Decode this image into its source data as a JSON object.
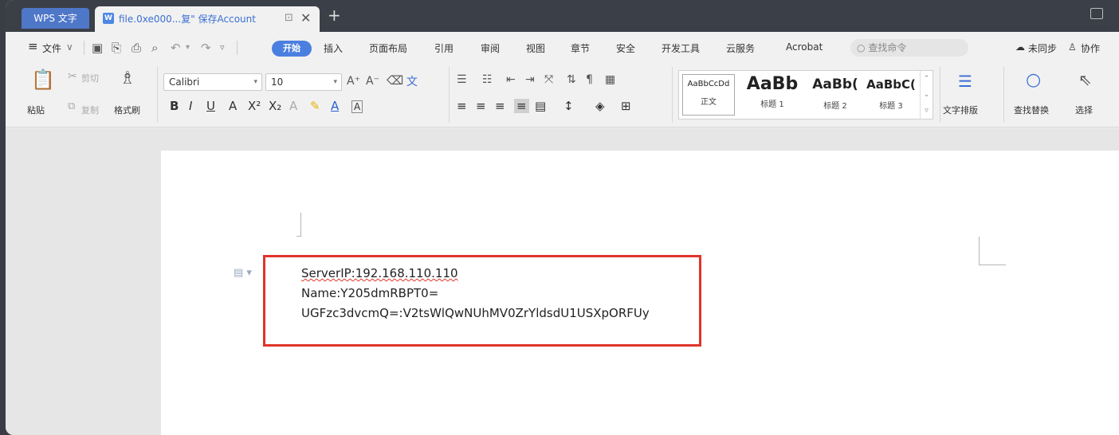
{
  "tabs": {
    "app": "WPS 文字",
    "document": "file.0xe000...复\" 保存Account",
    "new_tab": "+"
  },
  "menu": {
    "hamburger": "≡",
    "file": "文件",
    "start": "开始",
    "items": [
      "插入",
      "页面布局",
      "引用",
      "审阅",
      "视图",
      "章节",
      "安全",
      "开发工具",
      "云服务",
      "Acrobat"
    ],
    "search_placeholder": "查找命令",
    "sync": "未同步",
    "collab": "协作"
  },
  "ribbon": {
    "paste": "粘贴",
    "cut": "剪切",
    "copy": "复制",
    "format_painter": "格式刷",
    "font_name": "Calibri",
    "font_size": "10",
    "styles": [
      {
        "preview": "AaBbCcDd",
        "name": "正文"
      },
      {
        "preview": "AaBb",
        "name": "标题 1"
      },
      {
        "preview": "AaBb(",
        "name": "标题 2"
      },
      {
        "preview": "AaBbC(",
        "name": "标题 3"
      }
    ],
    "text_layout": "文字排版",
    "find_replace": "查找替换",
    "select": "选择"
  },
  "document": {
    "lines": [
      "ServerIP:192.168.110.110",
      "Name:Y205dmRBPT0=",
      "UGFzc3dvcmQ=:V2tsWlQwNUhMV0ZrYldsdU1USXpORFUy"
    ]
  },
  "colors": {
    "accent": "#4a7fe0",
    "highlight_box": "#e0342c",
    "tabbar": "#3b3f48"
  }
}
